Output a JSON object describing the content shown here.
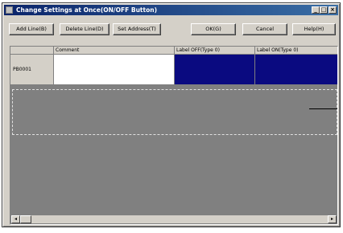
{
  "window": {
    "title": "Change Settings at Once(ON/OFF Button)"
  },
  "titlebar_buttons": {
    "minimize": "_",
    "maximize": "□",
    "close": "×"
  },
  "toolbar": {
    "add_line": "Add Line(B)",
    "delete_line": "Delete Line(D)",
    "set_address": "Set Address(T)",
    "ok": "OK(G)",
    "cancel": "Cancel",
    "help": "Help(H)"
  },
  "grid": {
    "columns": [
      "Comment",
      "Label OFF(Type 0)",
      "Label ON(Type 0)"
    ],
    "rows": [
      {
        "header": "PB0001",
        "comment": "",
        "label_off": "",
        "label_on": ""
      }
    ]
  },
  "scrollbar": {
    "left_arrow": "◂",
    "right_arrow": "▸"
  },
  "colors": {
    "title_start": "#0a246a",
    "title_end": "#3a6ea5",
    "selection": "#0a0a80",
    "face": "#d4d0c8"
  }
}
